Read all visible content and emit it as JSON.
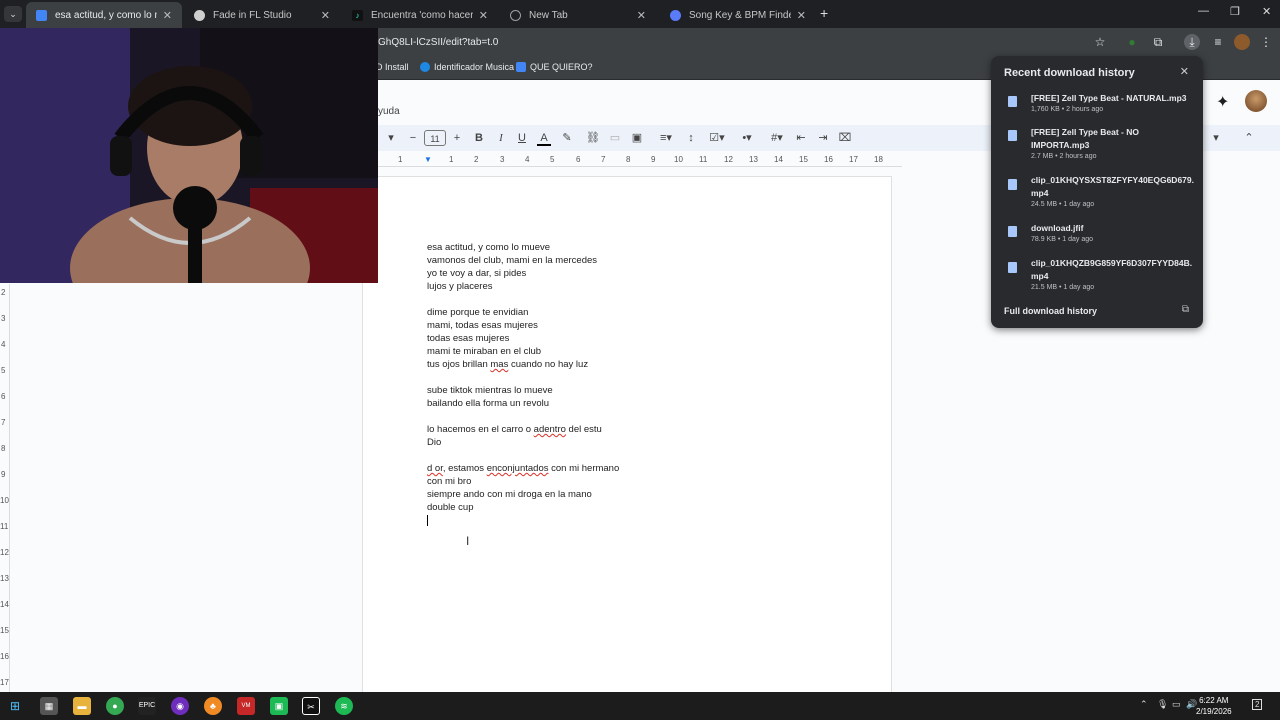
{
  "browser": {
    "tabs": [
      {
        "label": "esa actitud, y como lo mueve -",
        "icon": "docs-icon",
        "color": "#4285f4"
      },
      {
        "label": "Fade in FL Studio",
        "icon": "chatgpt-icon",
        "color": "#cfcfcf"
      },
      {
        "label": "Encuentra 'como hacer un fade",
        "icon": "tiktok-icon",
        "color": "#111111"
      },
      {
        "label": "New Tab",
        "icon": "chrome-icon",
        "color": "#9aa0a6"
      },
      {
        "label": "Song Key & BPM Finder | Tunel",
        "icon": "tunebat-icon",
        "color": "#5b7cfa"
      }
    ],
    "url": "GhQ8LI-lCzSII/edit?tab=t.0",
    "bookmarks": [
      {
        "label": "D Install"
      },
      {
        "label": "Identificador Musica"
      },
      {
        "label": "QUE QUIERO?"
      }
    ]
  },
  "docs": {
    "menu_fragment": "yuda",
    "font_size": "11",
    "ruler_numbers": [
      "1",
      "1",
      "2",
      "3",
      "4",
      "5",
      "6",
      "7",
      "8",
      "9",
      "10",
      "11",
      "12",
      "13",
      "14",
      "15",
      "16",
      "17",
      "18"
    ],
    "vruler_numbers": [
      "2",
      "3",
      "4",
      "5",
      "6",
      "7",
      "8",
      "9",
      "10",
      "11",
      "12",
      "13",
      "14",
      "15",
      "16",
      "17"
    ],
    "lines": [
      "esa actitud, y como lo mueve",
      "vamonos del club, mami en la mercedes",
      "yo te voy a dar, si pides",
      "lujos y placeres",
      "",
      "dime porque te envidian",
      "mami, todas esas mujeres",
      "todas esas mujeres",
      "mami te miraban en el club",
      "tus ojos brillan mas cuando no hay luz",
      "",
      "sube tiktok mientras lo mueve",
      "bailando ella forma un revolu",
      "",
      "lo hacemos en el carro o adentro del estu",
      "Dio",
      "",
      "d or, estamos enconjuntados con mi hermano",
      "con mi bro",
      "siempre ando con mi droga en la mano",
      "double cup"
    ],
    "spell_words": [
      "mas",
      "adentro",
      "d or",
      "enconjuntados"
    ]
  },
  "downloads": {
    "title": "Recent download history",
    "items": [
      {
        "name": "[FREE] Zell Type Beat - NATURAL.mp3",
        "meta": "1,760 KB • 2 hours ago"
      },
      {
        "name": "[FREE] Zell Type Beat - NO IMPORTA.mp3",
        "meta": "2.7 MB • 2 hours ago"
      },
      {
        "name": "clip_01KHQYSXST8ZFYFY40EQG6D679.mp4",
        "meta": "24.5 MB • 1 day ago"
      },
      {
        "name": "download.jfif",
        "meta": "78.9 KB • 1 day ago"
      },
      {
        "name": "clip_01KHQZB9G859YF6D307FYYD84B.mp4",
        "meta": "21.5 MB • 1 day ago"
      }
    ],
    "full_history": "Full download history"
  },
  "taskbar": {
    "time": "6:22 AM",
    "date": "2/19/2026",
    "notifications": "2"
  }
}
